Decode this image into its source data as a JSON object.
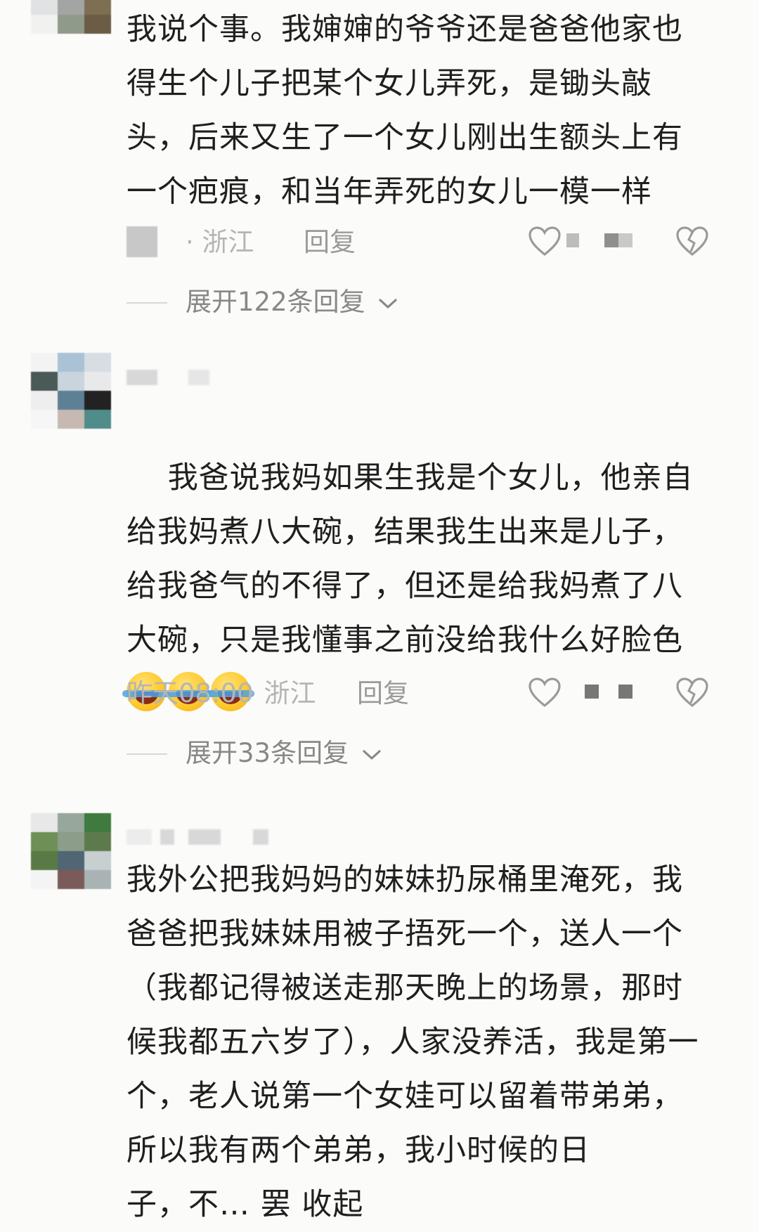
{
  "comments": [
    {
      "text": "我说个事。我婶婶的爷爷还是爸爸他家也得生个儿子把某个女儿弄死，是锄头敲头，后来又生了一个女儿刚出生额头上有一个疤痕，和当年弄死的女儿一模一样",
      "time": "",
      "location": "· 浙江",
      "reply": "回复",
      "expand": "展开122条回复"
    },
    {
      "text": "我爸说我妈如果生我是个女儿，他亲自给我妈煮八大碗，结果我生出来是儿子，给我爸气的不得了，但还是给我妈煮了八大碗，只是我懂事之前没给我什么好脸色",
      "time": "昨天08:00",
      "location": "· 浙江",
      "reply": "回复",
      "expand": "展开33条回复"
    },
    {
      "text": "我外公把我妈妈的妹妹扔尿桶里淹死，我爸爸把我妹妹用被子捂死一个，送人一个（我都记得被送走那天晚上的场景，那时候我都五六岁了），人家没养活，我是第一个，老人说第一个女娃可以留着带弟弟，所以我有两个弟弟，我小时候的日",
      "text_cut": "子，不… 罢 收起"
    }
  ],
  "icons": {
    "like": "heart-outline-icon",
    "dislike": "broken-heart-icon",
    "expand": "chevron-down-icon",
    "emoji": "tears-of-joy-emoji"
  },
  "colors": {
    "text": "#1f1f1f",
    "meta": "#b5b5b5",
    "reply": "#9a9a9a",
    "expand": "#888888",
    "background": "#fbfbf9"
  }
}
